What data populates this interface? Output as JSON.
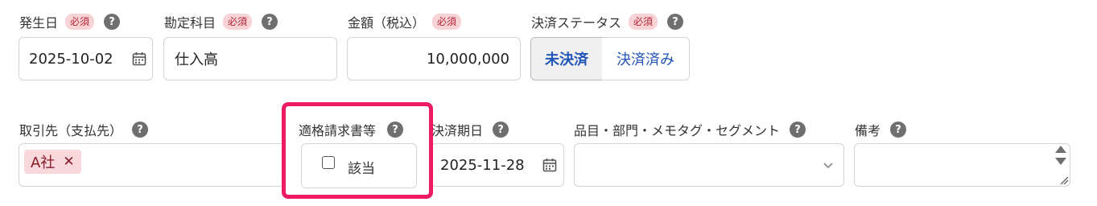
{
  "required_badge": "必須",
  "help_glyph": "?",
  "row1": {
    "date": {
      "label": "発生日",
      "value": "2025-10-02"
    },
    "account": {
      "label": "勘定科目",
      "value": "仕入高"
    },
    "amount": {
      "label": "金額（税込）",
      "value": "10,000,000"
    },
    "status": {
      "label": "決済ステータス",
      "options": [
        "未決済",
        "決済済み"
      ],
      "selected": "未決済"
    }
  },
  "row2": {
    "partner": {
      "label": "取引先（支払先）",
      "tag": "A社",
      "tag_remove": "✕"
    },
    "invoice": {
      "label": "適格請求書等",
      "checkbox_label": "該当",
      "checked": false
    },
    "due_date": {
      "label": "決済期日",
      "value": "2025-11-28"
    },
    "segment": {
      "label": "品目・部門・メモタグ・セグメント",
      "value": ""
    },
    "notes": {
      "label": "備考",
      "value": ""
    }
  },
  "colors": {
    "accent": "#2255b8",
    "highlight": "#ee1b63",
    "required_bg": "#f7d3d6",
    "tag_bg": "#f8d8db"
  }
}
